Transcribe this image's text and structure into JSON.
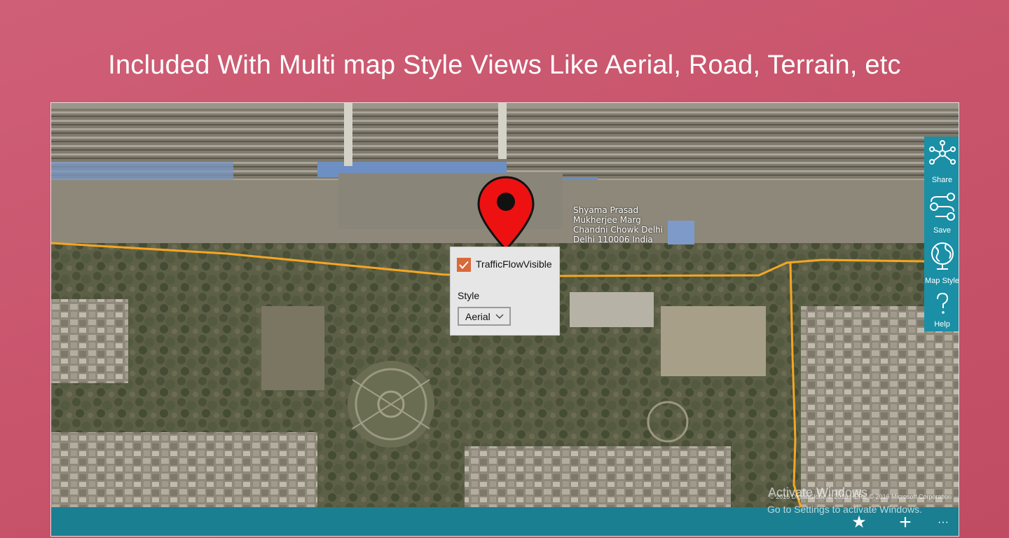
{
  "headline": "Included With Multi map Style Views Like Aerial, Road, Terrain, etc",
  "map": {
    "address_lines": [
      "Shyama Prasad",
      "Mukherjee Marg",
      "Chandni Chowk Delhi",
      "Delhi 110006 India"
    ],
    "copyright": "© 2016 DigitalGlobe © 2016 HERE © 2016 Microsoft Corporation"
  },
  "popup": {
    "traffic_label": "TrafficFlowVisible",
    "traffic_checked": true,
    "style_label": "Style",
    "style_value": "Aerial"
  },
  "side_panel": {
    "items": [
      {
        "label": "Share",
        "icon": "share-network-icon"
      },
      {
        "label": "Save",
        "icon": "save-route-icon"
      },
      {
        "label": "Map Style",
        "icon": "globe-icon"
      },
      {
        "label": "Help",
        "icon": "help-icon"
      }
    ]
  },
  "bottom_bar": {
    "star": "★",
    "add": "+",
    "more": "···"
  },
  "watermark": {
    "line1": "Activate Windows",
    "line2": "Go to Settings to activate Windows."
  },
  "colors": {
    "side_panel": "#1a8fa6",
    "bottom_bar": "#1a7f90",
    "checkbox": "#d9683a",
    "pin": "#ee1111",
    "route": "#f5a623"
  }
}
